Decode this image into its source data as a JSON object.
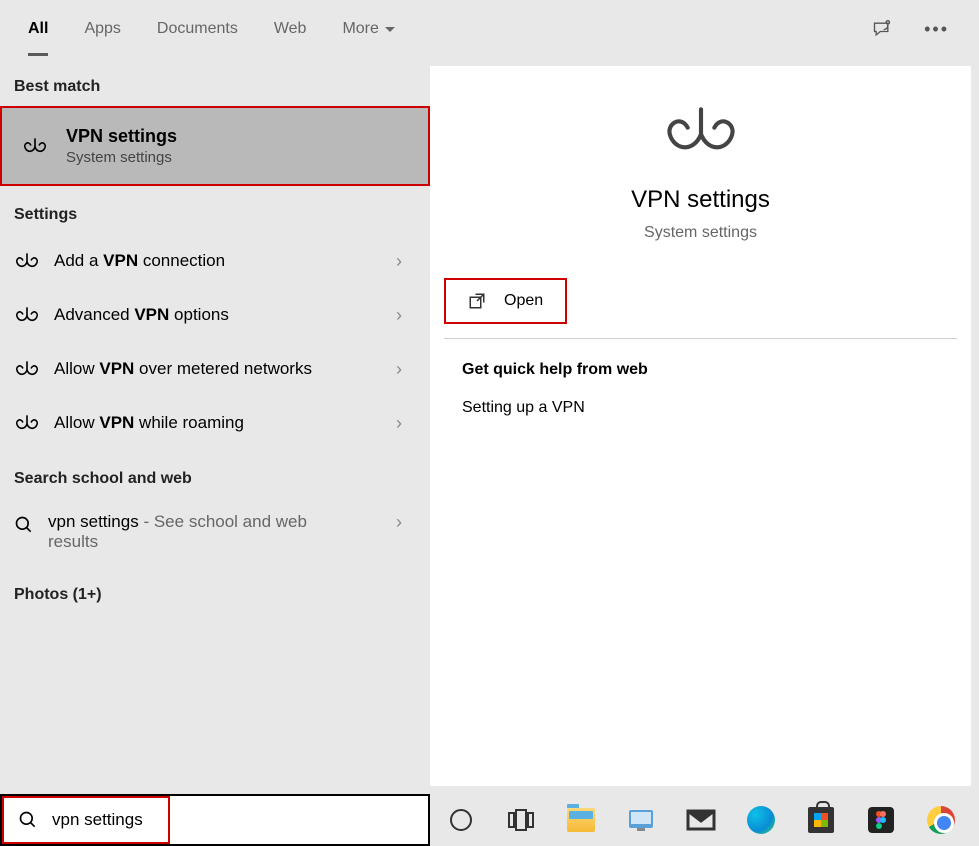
{
  "tabs": {
    "all": "All",
    "apps": "Apps",
    "documents": "Documents",
    "web": "Web",
    "more": "More"
  },
  "sections": {
    "best_match": "Best match",
    "settings": "Settings",
    "search_web": "Search school and web",
    "photos": "Photos (1+)"
  },
  "best_match": {
    "title": "VPN settings",
    "subtitle": "System settings"
  },
  "settings_items": {
    "item0": {
      "prefix": "Add a ",
      "bold": "VPN",
      "suffix": " connection"
    },
    "item1": {
      "prefix": "Advanced ",
      "bold": "VPN",
      "suffix": " options"
    },
    "item2": {
      "prefix": "Allow ",
      "bold": "VPN",
      "suffix": " over metered networks"
    },
    "item3": {
      "prefix": "Allow ",
      "bold": "VPN",
      "suffix": " while roaming"
    }
  },
  "web_search": {
    "query": "vpn settings",
    "suffix": " - See school and web results"
  },
  "detail": {
    "title": "VPN settings",
    "subtitle": "System settings",
    "open_label": "Open",
    "help_header": "Get quick help from web",
    "help_link": "Setting up a VPN"
  },
  "search_box": {
    "value": "vpn settings"
  }
}
